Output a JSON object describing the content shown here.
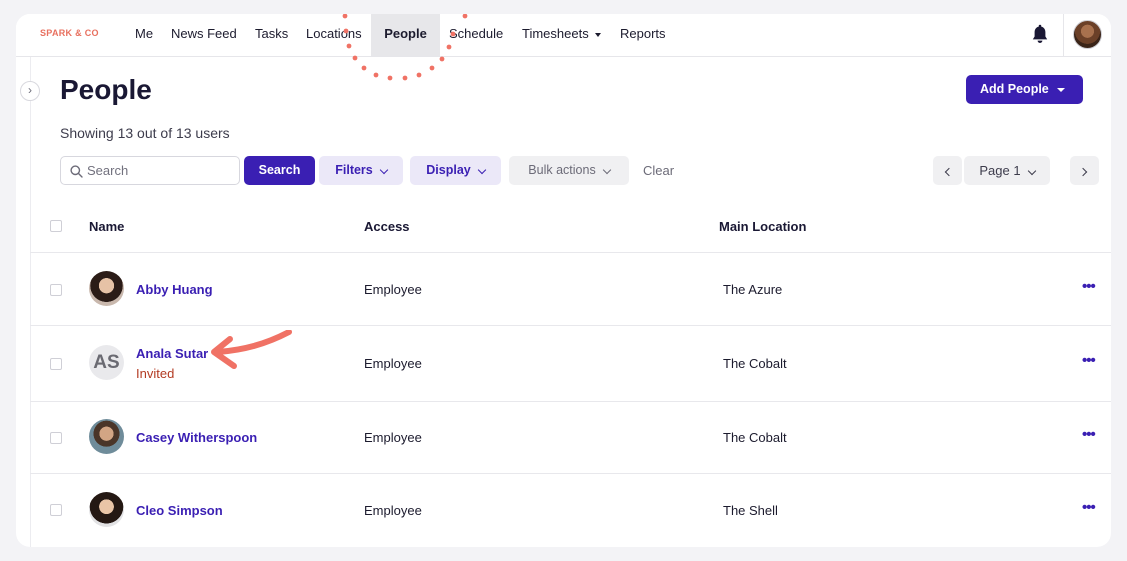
{
  "brand": "SPARK & CO",
  "nav": {
    "items": [
      {
        "label": "Me"
      },
      {
        "label": "News Feed"
      },
      {
        "label": "Tasks"
      },
      {
        "label": "Locations"
      },
      {
        "label": "People",
        "active": true
      },
      {
        "label": "Schedule"
      },
      {
        "label": "Timesheets",
        "dropdown": true
      },
      {
        "label": "Reports"
      }
    ],
    "bell_icon": "bell-icon",
    "avatar": "user-avatar"
  },
  "page": {
    "title": "People",
    "add_button": "Add People",
    "showing": "Showing 13 out of 13 users"
  },
  "toolbar": {
    "search_placeholder": "Search",
    "search_button": "Search",
    "filters": "Filters",
    "display": "Display",
    "bulk_actions": "Bulk actions",
    "clear": "Clear",
    "page_label": "Page 1"
  },
  "table": {
    "columns": [
      "Name",
      "Access",
      "Main Location"
    ],
    "rows": [
      {
        "name": "Abby Huang",
        "status": "",
        "access": "Employee",
        "location": "The Azure",
        "avatar": "photo"
      },
      {
        "name": "Anala Sutar",
        "status": "Invited",
        "access": "Employee",
        "location": "The Cobalt",
        "avatar": "initials",
        "initials": "AS"
      },
      {
        "name": "Casey Witherspoon",
        "status": "",
        "access": "Employee",
        "location": "The Cobalt",
        "avatar": "photo"
      },
      {
        "name": "Cleo Simpson",
        "status": "",
        "access": "Employee",
        "location": "The Shell",
        "avatar": "photo"
      }
    ],
    "more_label": "•••"
  },
  "colors": {
    "accent": "#3a1fb3",
    "brand": "#e8705f",
    "invited": "#b33b23",
    "annotation": "#f07265"
  }
}
